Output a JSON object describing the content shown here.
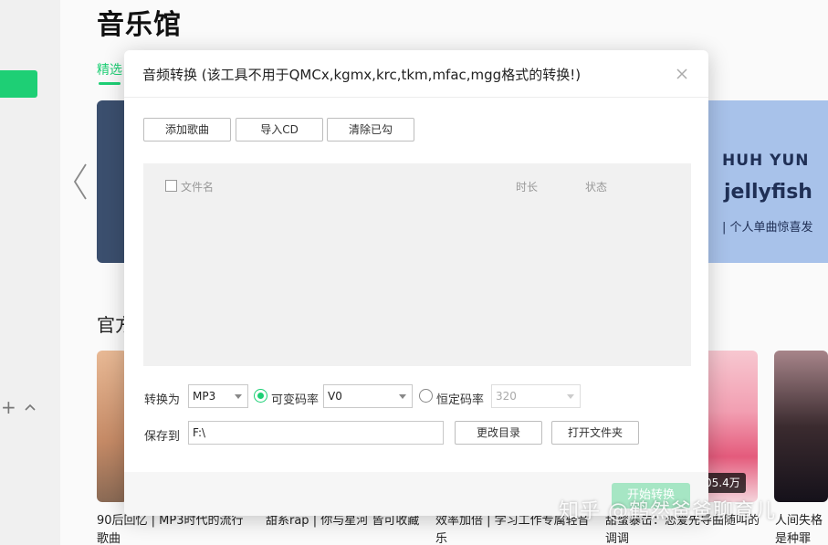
{
  "page": {
    "title": "音乐馆",
    "tab_selected": "精选",
    "section_title": "官方",
    "banner_right": {
      "line1": "HUH YUN",
      "line2": "jellyfish",
      "line3": "| 个人单曲惊喜发"
    },
    "cards": [
      {
        "caption": "90后回忆 | MP3时代的流行歌曲"
      },
      {
        "caption": "甜系rap | 你与星河 皆可收藏"
      },
      {
        "caption": "效率加倍 | 学习工作专属轻音乐"
      },
      {
        "caption": "甜蜜暴击：恋爱先导曲随叫的调调"
      },
      {
        "caption": "人间失格是种罪"
      }
    ],
    "play_count": "05.4万",
    "watermark": "知乎 @鹤然爸爸聊育儿"
  },
  "dialog": {
    "title": "音频转换 (该工具不用于QMCx,kgmx,krc,tkm,mfac,mgg格式的转换!)",
    "buttons": {
      "add_song": "添加歌曲",
      "import_cd": "导入CD",
      "clear_checked": "清除已勾"
    },
    "list_columns": {
      "filename": "文件名",
      "duration": "时长",
      "status": "状态"
    },
    "convert_label": "转换为",
    "format": {
      "selected": "MP3"
    },
    "vbr": {
      "label": "可变码率",
      "selected": "V0",
      "checked": true
    },
    "cbr": {
      "label": "恒定码率",
      "selected": "320",
      "checked": false
    },
    "save_label": "保存到",
    "save_path": "F:\\",
    "change_dir": "更改目录",
    "open_folder": "打开文件夹",
    "start": "开始转换"
  },
  "colors": {
    "accent": "#1ecf75",
    "start_disabled": "#a6e6c4"
  }
}
